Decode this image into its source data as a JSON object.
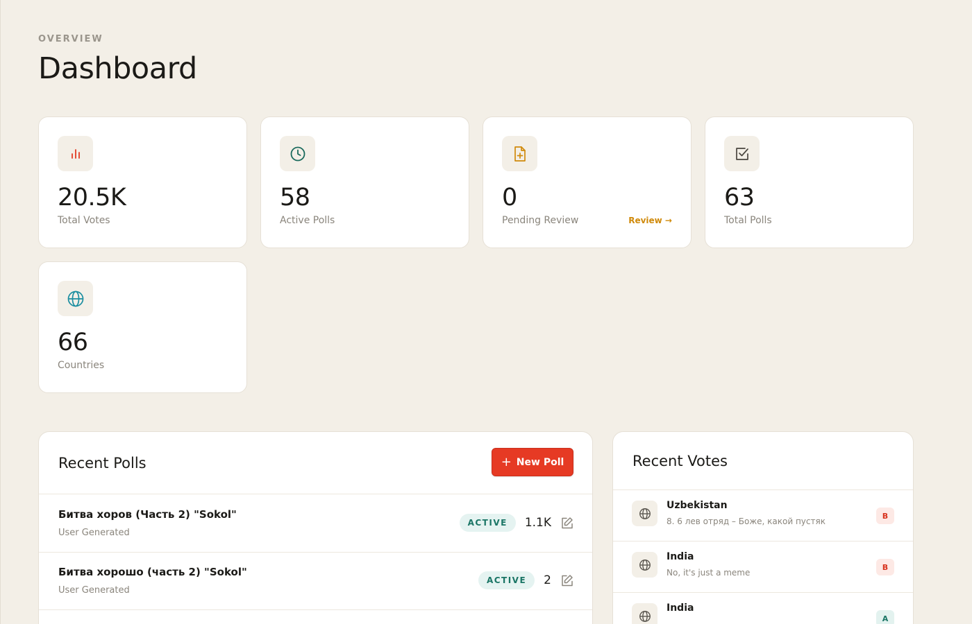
{
  "header": {
    "eyebrow": "OVERVIEW",
    "title": "Dashboard"
  },
  "stats": [
    {
      "value": "20.5K",
      "label": "Total Votes",
      "icon": "bar-chart-icon",
      "icon_color": "#e23b24"
    },
    {
      "value": "58",
      "label": "Active Polls",
      "icon": "clock-icon",
      "icon_color": "#1a6a5c"
    },
    {
      "value": "0",
      "label": "Pending Review",
      "icon": "file-plus-icon",
      "icon_color": "#d08a0b",
      "link_label": "Review →"
    },
    {
      "value": "63",
      "label": "Total Polls",
      "icon": "check-square-icon",
      "icon_color": "#4a463f"
    },
    {
      "value": "66",
      "label": "Countries",
      "icon": "globe-icon",
      "icon_color": "#1b8ea0"
    }
  ],
  "recent_polls": {
    "title": "Recent Polls",
    "new_button_label": "New Poll",
    "rows": [
      {
        "title": "Битва хоров (Часть 2) \"Sokol\"",
        "source": "User Generated",
        "status": "ACTIVE",
        "votes": "1.1K"
      },
      {
        "title": "Битва хорошо (часть 2) \"Sokol\"",
        "source": "User Generated",
        "status": "ACTIVE",
        "votes": "2"
      }
    ]
  },
  "recent_votes": {
    "title": "Recent Votes",
    "rows": [
      {
        "country": "Uzbekistan",
        "answer": "8. 6 лев отряд – Боже, какой пустяк",
        "option": "B"
      },
      {
        "country": "India",
        "answer": "No, it's just a meme",
        "option": "B"
      },
      {
        "country": "India",
        "answer": "",
        "option": "A"
      }
    ]
  },
  "colors": {
    "background": "#f3efe7",
    "primary_button": "#e63a24",
    "active_badge": "#1a7565",
    "review_link": "#d08a0b"
  }
}
